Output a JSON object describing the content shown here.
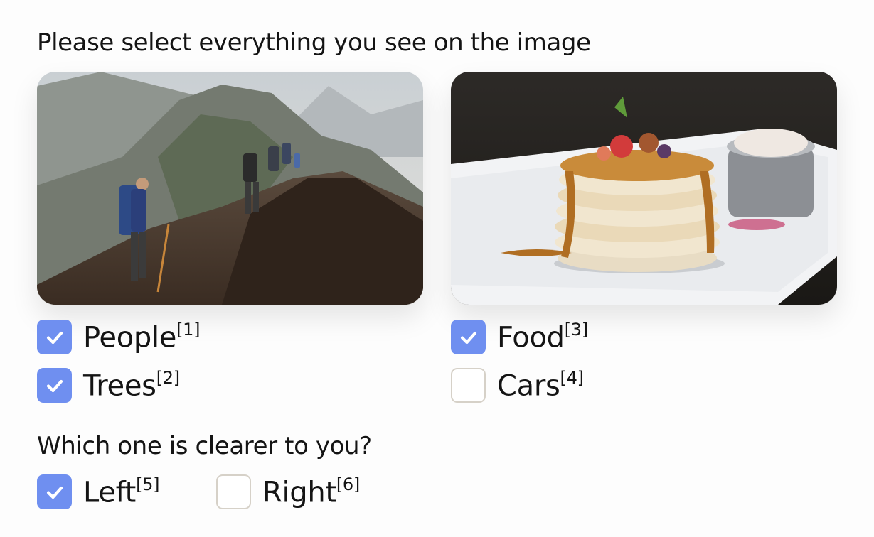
{
  "prompt": {
    "question_1": "Please select everything you see on the image",
    "question_2": "Which one is clearer to you?"
  },
  "images": {
    "left": {
      "subject": "hikers on mountain ridge"
    },
    "right": {
      "subject": "stack of pancakes with berries and syrup"
    }
  },
  "colors": {
    "checked": "#6f8ff0",
    "unchecked_border": "#d6d1c8",
    "text": "#141414"
  },
  "options": [
    {
      "label": "People",
      "ref": "[1]",
      "checked": true
    },
    {
      "label": "Trees",
      "ref": "[2]",
      "checked": true
    },
    {
      "label": "Food",
      "ref": "[3]",
      "checked": true
    },
    {
      "label": "Cars",
      "ref": "[4]",
      "checked": false
    },
    {
      "label": "Left",
      "ref": "[5]",
      "checked": true
    },
    {
      "label": "Right",
      "ref": "[6]",
      "checked": false
    }
  ]
}
